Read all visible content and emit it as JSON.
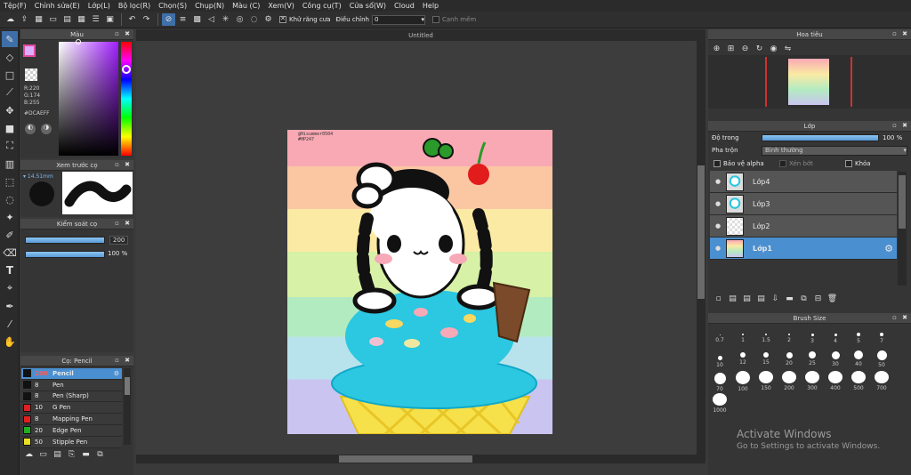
{
  "menu": [
    "Tệp(F)",
    "Chỉnh sửa(E)",
    "Lớp(L)",
    "Bộ lọc(R)",
    "Chọn(S)",
    "Chụp(N)",
    "Màu (C)",
    "Xem(V)",
    "Công cụ(T)",
    "Cửa sổ(W)",
    "Cloud",
    "Help"
  ],
  "toolbar": {
    "antialias_label": "Khử răng cưa",
    "adjust_label": "Điều chỉnh",
    "adjust_value": "0",
    "snap_label": "Cạnh mềm"
  },
  "color_panel": {
    "title": "Màu",
    "r": "R:220",
    "g": "G:174",
    "b": "B:255",
    "hex": "#DCAEFF",
    "fg_color": "#DCAEFF"
  },
  "brush_preview": {
    "title": "Xem trước cọ",
    "size": "14.51mm"
  },
  "brush_control": {
    "title": "Kiểm soát cọ",
    "size": "200",
    "opacity": "100 %"
  },
  "brush_panel": {
    "title": "Cọ: Pencil",
    "items": [
      {
        "size": "200",
        "name": "Pencil",
        "color": "#111111",
        "selected": true
      },
      {
        "size": "8",
        "name": "Pen",
        "color": "#111111",
        "selected": false
      },
      {
        "size": "8",
        "name": "Pen (Sharp)",
        "color": "#111111",
        "selected": false
      },
      {
        "size": "10",
        "name": "G Pen",
        "color": "#e02020",
        "selected": false
      },
      {
        "size": "8",
        "name": "Mapping Pen",
        "color": "#e02020",
        "selected": false
      },
      {
        "size": "20",
        "name": "Edge Pen",
        "color": "#20b020",
        "selected": false
      },
      {
        "size": "50",
        "name": "Stipple Pen",
        "color": "#e8e020",
        "selected": false
      }
    ]
  },
  "document": {
    "tab": "Untitled",
    "signature_line1": "@Hisummer0504",
    "signature_line2": "#HP247"
  },
  "navigator": {
    "title": "Hoa tiêu"
  },
  "layers_panel": {
    "title": "Lớp",
    "opacity_label": "Độ trong",
    "opacity_value": "100 %",
    "opacity_fraction": 1.0,
    "blend_label": "Pha trộn",
    "blend_value": "Bình thường",
    "protect_alpha": "Bảo vệ alpha",
    "clipping": "Xén bớt",
    "lock": "Khóa",
    "layers": [
      {
        "name": "Lớp4",
        "selected": false
      },
      {
        "name": "Lớp3",
        "selected": false
      },
      {
        "name": "Lớp2",
        "selected": false
      },
      {
        "name": "Lớp1",
        "selected": true
      }
    ]
  },
  "brush_size_panel": {
    "title": "Brush Size",
    "sizes": [
      "0.7",
      "1",
      "1.5",
      "2",
      "3",
      "4",
      "5",
      "7",
      "10",
      "12",
      "15",
      "20",
      "25",
      "30",
      "40",
      "50",
      "70",
      "100",
      "150",
      "200",
      "300",
      "400",
      "500",
      "700",
      "1000"
    ]
  },
  "watermark": {
    "line1": "Activate Windows",
    "line2": "Go to Settings to activate Windows."
  }
}
